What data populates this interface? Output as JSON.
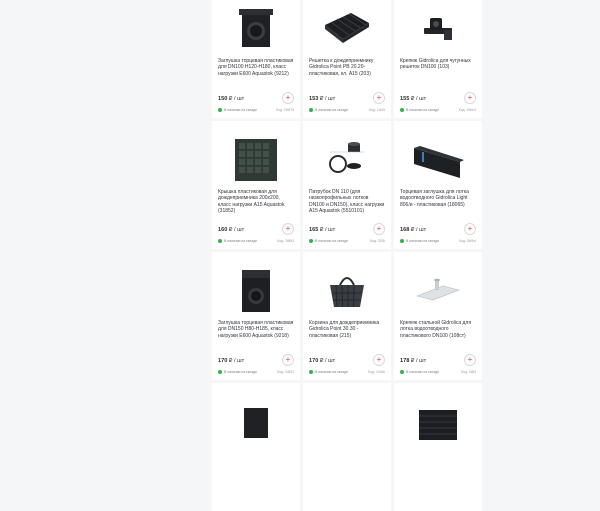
{
  "currency_unit": "₽ / шт",
  "stock_text": "В наличии на складе",
  "cards": [
    {
      "icon": "end-cap-icon",
      "title": "Заглушка торцевая пластиковая для DN100 H120-H180, класс нагрузки E600 Aquastok (9212)",
      "price": "150",
      "sku": "Код: 2i9875"
    },
    {
      "icon": "grate-icon",
      "title": "Решетка к дождеприемнику Gidrolica Point РВ 20.20-пластиковая, кл. A15 (203)",
      "price": "153",
      "sku": "Код: 14i05"
    },
    {
      "icon": "clamp-icon",
      "title": "Крепеж Gidrolica для чугунных решеток DN100 (103)",
      "price": "155",
      "sku": "Код: 15eeЗ"
    },
    {
      "icon": "plastic-cover-icon",
      "title": "Крышка пластиковая для дождеприемника 200x200, класс нагрузки A15 Aquastok (31852)",
      "price": "160",
      "sku": "Код: 2i56i3"
    },
    {
      "icon": "pipe-fitting-icon",
      "title": "Патрубок DN 110 (для низкопрофильных лотков DN100 и DN150), класс нагрузки A15 Aquastok (5510101)",
      "price": "165",
      "sku": "Код: 32i3i"
    },
    {
      "icon": "channel-end-cap-icon",
      "title": "Торцевая заглушка для лотка водоотводного Gidrolica Light 806/и - пластиковая (18065)",
      "price": "168",
      "sku": "Код: 34i9nt"
    },
    {
      "icon": "end-cap-icon",
      "title": "Заглушка торцевая пластиковая для DN150 H80-H185, класс нагрузки E600 Aquastok (9218)",
      "price": "170",
      "sku": "Код: 2i4i03"
    },
    {
      "icon": "basket-icon",
      "title": "Корзина для дождеприемника Gidrolica Point 30.30 - пластиковая (215)",
      "price": "170",
      "sku": "Код: 24i16i"
    },
    {
      "icon": "steel-bracket-icon",
      "title": "Крепеж стальной Gidrolica для лотка водоотводного пластикового DN100 (108ст)",
      "price": "178",
      "sku": "Код: 2i8i4"
    },
    {
      "icon": "end-cap-icon",
      "title": "",
      "price": "",
      "sku": ""
    },
    {
      "icon": "blank-icon",
      "title": "",
      "price": "",
      "sku": ""
    },
    {
      "icon": "grate-icon",
      "title": "",
      "price": "",
      "sku": ""
    }
  ]
}
